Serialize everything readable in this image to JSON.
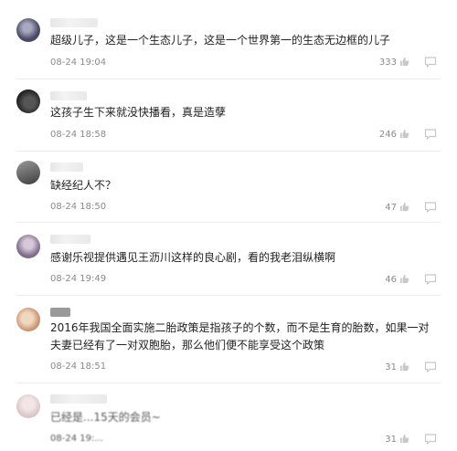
{
  "comments": [
    {
      "text": "超级儿子，这是一个生态儿子，这是一个世界第一的生态无边框的儿子",
      "time": "08-24 19:04",
      "likes": "333",
      "avatar_color": "#4a4a66"
    },
    {
      "text": "这孩子生下来就没快播看，真是造孽",
      "time": "08-24 18:58",
      "likes": "246",
      "avatar_color": "#2e2e2e"
    },
    {
      "text": "缺经纪人不？",
      "time": "08-24 18:50",
      "likes": "47",
      "avatar_color": "#5a5a5a"
    },
    {
      "text": "感谢乐视提供遇见王沥川这样的良心剧，看的我老泪纵横啊",
      "time": "08-24 19:49",
      "likes": "46",
      "avatar_color": "#7c6c8c"
    },
    {
      "text": "2016年我国全面实施二胎政策是指孩子的个数，而不是生育的胎数，如果一对夫妻已经有了一对双胞胎，那么他们便不能享受这个政策",
      "time": "08-24 18:51",
      "likes": "31",
      "avatar_color": "#c58b6a"
    },
    {
      "text": "已经是...15天的会员~",
      "time": "08-24 19:...",
      "likes": "31",
      "avatar_color": "#d9c4c4"
    }
  ],
  "icons": {
    "like": "thumbs-up-icon",
    "more": "comment-more-icon"
  }
}
